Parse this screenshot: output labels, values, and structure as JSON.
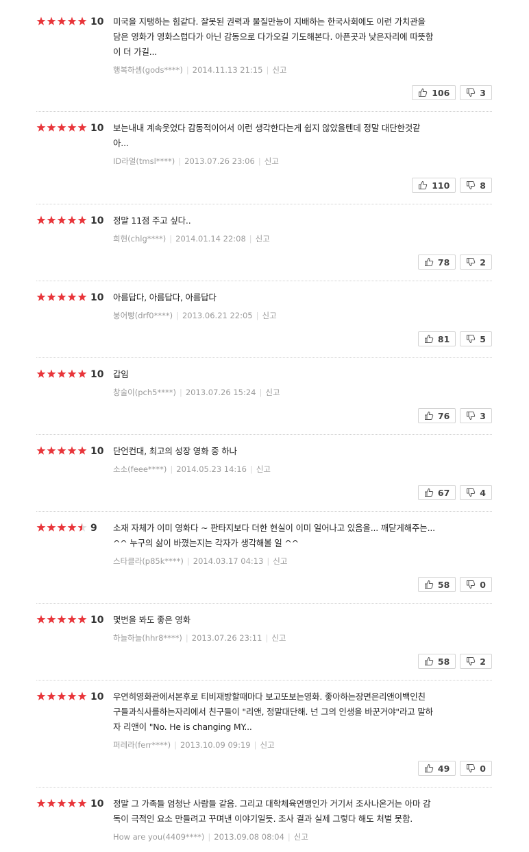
{
  "colors": {
    "star": "#e8353a",
    "star_empty": "#dddddd"
  },
  "reviews": [
    {
      "rating": 5,
      "score": "10",
      "lines": [
        "미국을 지탱하는 힘같다. 잘못된 권력과 물질만능이 지배하는 한국사회에도 이런 가치관을",
        "담은 영화가 영화스럽다가 아닌 감동으로 다가오길 기도해본다. 아픈곳과 낮은자리에 따뜻함",
        "이 더 가길..."
      ],
      "user": "행복하셈(gods****)",
      "date": "2014.11.13 21:15",
      "report": "신고",
      "likes": "106",
      "dislikes": "3"
    },
    {
      "rating": 5,
      "score": "10",
      "lines": [
        "보는내내 계속웃었다 감동적이어서 이런 생각한다는게 쉽지 않았을텐데 정말 대단한것같",
        "아..."
      ],
      "user": "ID라얼(tmsl****)",
      "date": "2013.07.26 23:06",
      "report": "신고",
      "likes": "110",
      "dislikes": "8"
    },
    {
      "rating": 5,
      "score": "10",
      "lines": [
        "정말 11점 주고 싶다.."
      ],
      "user": "희현(chlg****)",
      "date": "2014.01.14 22:08",
      "report": "신고",
      "likes": "78",
      "dislikes": "2"
    },
    {
      "rating": 5,
      "score": "10",
      "lines": [
        "아름답다, 아름답다, 아름답다"
      ],
      "user": "붕어빵(drf0****)",
      "date": "2013.06.21 22:05",
      "report": "신고",
      "likes": "81",
      "dislikes": "5"
    },
    {
      "rating": 5,
      "score": "10",
      "lines": [
        "갑임"
      ],
      "user": "창술이(pch5****)",
      "date": "2013.07.26 15:24",
      "report": "신고",
      "likes": "76",
      "dislikes": "3"
    },
    {
      "rating": 5,
      "score": "10",
      "lines": [
        "단언컨대, 최고의 성장 영화 중 하나"
      ],
      "user": "소소(feee****)",
      "date": "2014.05.23 14:16",
      "report": "신고",
      "likes": "67",
      "dislikes": "4"
    },
    {
      "rating": 4.5,
      "score": "9",
      "lines": [
        "소재 자체가 이미 영화다 ~ 판타지보다 더한 현실이 이미 일어나고 있음을... 깨닫게해주는...",
        "^^ 누구의 삶이 바꼈는지는 각자가 생각해볼 일 ^^"
      ],
      "user": "스타클라(p85k****)",
      "date": "2014.03.17 04:13",
      "report": "신고",
      "likes": "58",
      "dislikes": "0"
    },
    {
      "rating": 5,
      "score": "10",
      "lines": [
        "몇번을 봐도 좋은 영화"
      ],
      "user": "하늘하늘(hhr8****)",
      "date": "2013.07.26 23:11",
      "report": "신고",
      "likes": "58",
      "dislikes": "2"
    },
    {
      "rating": 5,
      "score": "10",
      "lines": [
        "우연히영화관에서본후로 티비재방할때마다 보고또보는영화. 좋아하는장면은리앤이백인친",
        "구들과식사를하는자리에서 친구들이 \"리앤, 정말대단해. 넌 그의 인생을 바꾼거야\"라고 말하",
        "자 리앤이 \"No. He is changing MY..."
      ],
      "user": "퍼레라(ferr****)",
      "date": "2013.10.09 09:19",
      "report": "신고",
      "likes": "49",
      "dislikes": "0"
    },
    {
      "rating": 5,
      "score": "10",
      "lines": [
        "정말 그 가족들 엄청난 사람들 같음. 그리고 대학체육연맹인가 거기서 조사나온거는 아마 감",
        "독이 극적인 요소 만들려고 꾸며낸 이야기일듯. 조사 결과 실제 그렇다 해도 처벌 못함."
      ],
      "user": "How are you(4409****)",
      "date": "2013.09.08 08:04",
      "report": "신고",
      "likes": null,
      "dislikes": null
    }
  ]
}
